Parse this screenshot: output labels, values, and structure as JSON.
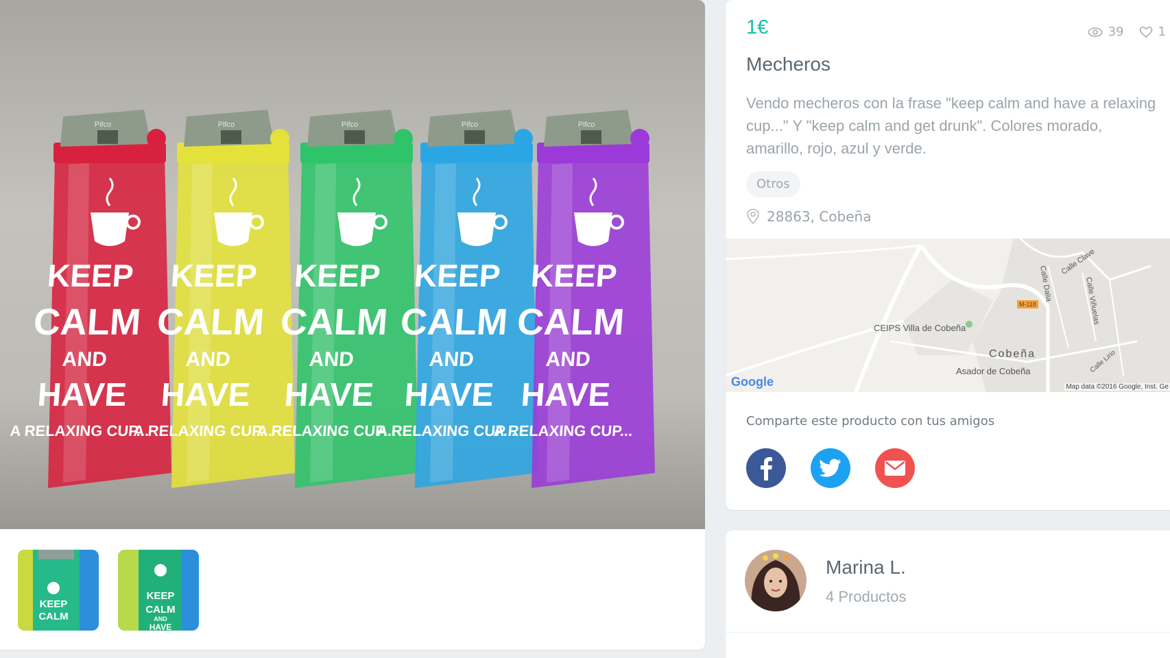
{
  "product": {
    "price": "1€",
    "views": "39",
    "favorites": "1",
    "title": "Mecheros",
    "description": "Vendo mecheros con la frase \"keep calm and have a relaxing cup...\" Y \"keep calm and get drunk\". Colores morado, amarillo, rojo, azul y verde.",
    "category": "Otros",
    "location": "28863, Cobeña"
  },
  "photo": {
    "line1": "KEEP",
    "line2": "CALM",
    "line3": "AND",
    "line4": "HAVE",
    "line5": "A RELAXING CUP...",
    "brand": "Pifco",
    "lighter_colors": [
      "#d8213f",
      "#e4e23a",
      "#2fc46a",
      "#2aa6e4",
      "#9b3ad8"
    ],
    "thumb_line1": "KEEP",
    "thumb_line2": "CALM",
    "thumb_line3": "AND",
    "thumb_line4": "HAVE"
  },
  "map": {
    "street_clave": "Calle Clave",
    "street_dalia": "Calle Dalia",
    "street_vinuelas": "Calle Viñuelas",
    "street_lirio": "Calle Lirio",
    "route": "M-118",
    "school": "CEIPS Villa de Cobeña",
    "town": "Cobeña",
    "restaurant": "Asador de Cobeña",
    "logo": "Google",
    "credit": "Map data ©2016 Google, Inst. Ge"
  },
  "share": {
    "title": "Comparte este producto con tus amigos",
    "icons": [
      "facebook-icon",
      "twitter-icon",
      "mail-icon"
    ],
    "colors": {
      "facebook": "#3b5998",
      "twitter": "#1da1f2",
      "mail": "#f05252"
    }
  },
  "seller": {
    "name": "Marina L.",
    "products": "4 Productos"
  },
  "colors": {
    "accent": "#13c1ac"
  }
}
